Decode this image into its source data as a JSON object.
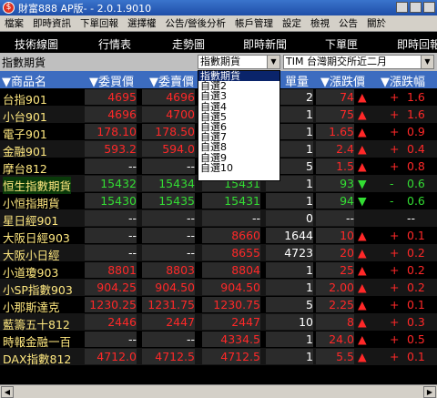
{
  "window": {
    "title": "財富888 AP版- - 2.0.1.9010",
    "logo": "$"
  },
  "menu": [
    "檔案",
    "即時資訊",
    "下單回報",
    "選擇權",
    "公告/營後分析",
    "帳戶管理",
    "設定",
    "檢視",
    "公告",
    "關於"
  ],
  "toolbar": [
    "技術線圖",
    "行情表",
    "走勢圖",
    "即時新聞",
    "下單匣",
    "即時回報"
  ],
  "selector": {
    "category": "指數期貨",
    "list_value": "指數期貨",
    "exchange_value": "TIM  台灣期交所近二月"
  },
  "dropdown": [
    "指數期貨",
    "自選2",
    "自選3",
    "自選4",
    "自選5",
    "自選6",
    "自選7",
    "自選8",
    "自選9",
    "自選10"
  ],
  "headers": [
    "▼商品名",
    "▼委買價",
    "▼委賣價",
    "單量",
    "▼漲跌價",
    "▼漲跌幅"
  ],
  "rows": [
    {
      "name": "台指901",
      "bid": "4695",
      "ask": "4696",
      "last": "",
      "vol": "2",
      "chg": "74",
      "arrow": "▲",
      "pct": "+",
      "pv": "1.6",
      "color": "red"
    },
    {
      "name": "小台901",
      "bid": "4696",
      "ask": "4700",
      "last": "",
      "vol": "1",
      "chg": "75",
      "arrow": "▲",
      "pct": "+",
      "pv": "1.6",
      "color": "red"
    },
    {
      "name": "電子901",
      "bid": "178.10",
      "ask": "178.50",
      "last": "",
      "vol": "1",
      "chg": "1.65",
      "arrow": "▲",
      "pct": "+",
      "pv": "0.9",
      "color": "red"
    },
    {
      "name": "金融901",
      "bid": "593.2",
      "ask": "594.0",
      "last": "",
      "vol": "1",
      "chg": "2.4",
      "arrow": "▲",
      "pct": "+",
      "pv": "0.4",
      "color": "red"
    },
    {
      "name": "摩台812",
      "bid": "--",
      "ask": "--",
      "last": "",
      "vol": "5",
      "chg": "1.5",
      "arrow": "▲",
      "pct": "+",
      "pv": "0.8",
      "color": "red"
    },
    {
      "name": "恒生指數期貨",
      "bid": "15432",
      "ask": "15434",
      "last": "15431",
      "vol": "1",
      "chg": "93",
      "arrow": "▼",
      "pct": "-",
      "pv": "0.6",
      "color": "green"
    },
    {
      "name": "小恒指期貨",
      "bid": "15430",
      "ask": "15435",
      "last": "15431",
      "vol": "1",
      "chg": "94",
      "arrow": "▼",
      "pct": "-",
      "pv": "0.6",
      "color": "green"
    },
    {
      "name": "星日經901",
      "bid": "--",
      "ask": "--",
      "last": "--",
      "vol": "0",
      "chg": "--",
      "arrow": "",
      "pct": "",
      "pv": "--",
      "color": "white"
    },
    {
      "name": "大阪日經903",
      "bid": "--",
      "ask": "--",
      "last": "8660",
      "vol": "1644",
      "chg": "10",
      "arrow": "▲",
      "pct": "+",
      "pv": "0.1",
      "color": "red"
    },
    {
      "name": "大阪小日經",
      "bid": "--",
      "ask": "--",
      "last": "8655",
      "vol": "4723",
      "chg": "20",
      "arrow": "▲",
      "pct": "+",
      "pv": "0.2",
      "color": "red"
    },
    {
      "name": "小道瓊903",
      "bid": "8801",
      "ask": "8803",
      "last": "8804",
      "vol": "1",
      "chg": "25",
      "arrow": "▲",
      "pct": "+",
      "pv": "0.2",
      "color": "red"
    },
    {
      "name": "小SP指數903",
      "bid": "904.25",
      "ask": "904.50",
      "last": "904.50",
      "vol": "1",
      "chg": "2.00",
      "arrow": "▲",
      "pct": "+",
      "pv": "0.2",
      "color": "red"
    },
    {
      "name": "小那斯達克",
      "bid": "1230.25",
      "ask": "1231.75",
      "last": "1230.75",
      "vol": "5",
      "chg": "2.25",
      "arrow": "▲",
      "pct": "+",
      "pv": "0.1",
      "color": "red"
    },
    {
      "name": "藍籌五十812",
      "bid": "2446",
      "ask": "2447",
      "last": "2447",
      "vol": "10",
      "chg": "8",
      "arrow": "▲",
      "pct": "+",
      "pv": "0.3",
      "color": "red"
    },
    {
      "name": "時報金融一百",
      "bid": "--",
      "ask": "--",
      "last": "4334.5",
      "vol": "1",
      "chg": "24.0",
      "arrow": "▲",
      "pct": "+",
      "pv": "0.5",
      "color": "red"
    },
    {
      "name": "DAX指數812",
      "bid": "4712.0",
      "ask": "4712.5",
      "last": "4712.5",
      "vol": "1",
      "chg": "5.5",
      "arrow": "▲",
      "pct": "+",
      "pv": "0.1",
      "color": "red"
    }
  ]
}
